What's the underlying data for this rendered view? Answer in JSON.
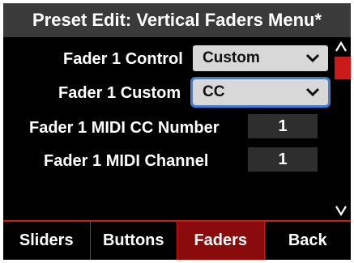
{
  "title": "Preset Edit: Vertical Faders Menu*",
  "rows": {
    "fader1_control": {
      "label": "Fader 1 Control",
      "value": "Custom"
    },
    "fader1_custom": {
      "label": "Fader 1 Custom",
      "value": "CC"
    },
    "fader1_cc_number": {
      "label": "Fader 1 MIDI CC Number",
      "value": "1"
    },
    "fader1_channel": {
      "label": "Fader 1 MIDI Channel",
      "value": "1"
    }
  },
  "scroll": {
    "up_icon": "chevron-up-icon",
    "down_icon": "chevron-down-icon"
  },
  "tabs": [
    {
      "label": "Sliders"
    },
    {
      "label": "Buttons"
    },
    {
      "label": "Faders"
    },
    {
      "label": "Back"
    }
  ],
  "colors": {
    "accent": "#cc1a1a",
    "active_tab": "#8a0b0b",
    "focus": "#3b7fd6",
    "title_bar": "#3a3a3a"
  }
}
